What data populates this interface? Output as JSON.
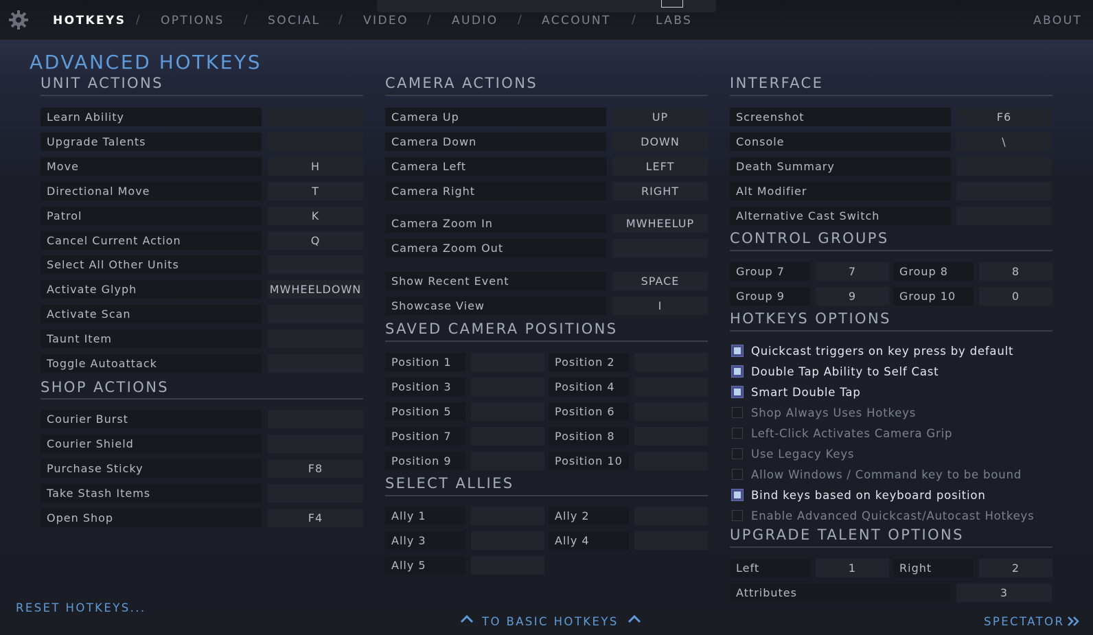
{
  "nav": {
    "tabs": [
      "HOTKEYS",
      "OPTIONS",
      "SOCIAL",
      "VIDEO",
      "AUDIO",
      "ACCOUNT",
      "LABS"
    ],
    "about": "ABOUT"
  },
  "page": {
    "title": "ADVANCED HOTKEYS"
  },
  "unit_actions": {
    "title": "UNIT ACTIONS",
    "rows": [
      {
        "label": "Learn Ability",
        "key": ""
      },
      {
        "label": "Upgrade Talents",
        "key": ""
      },
      {
        "label": "Move",
        "key": "H"
      },
      {
        "label": "Directional Move",
        "key": "T"
      },
      {
        "label": "Patrol",
        "key": "K"
      },
      {
        "label": "Cancel Current Action",
        "key": "Q"
      },
      {
        "label": "Select All Other Units",
        "key": ""
      },
      {
        "label": "Activate Glyph",
        "key": "MWHEELDOWN"
      },
      {
        "label": "Activate Scan",
        "key": ""
      },
      {
        "label": "Taunt Item",
        "key": ""
      },
      {
        "label": "Toggle Autoattack",
        "key": ""
      }
    ]
  },
  "shop_actions": {
    "title": "SHOP ACTIONS",
    "rows": [
      {
        "label": "Courier Burst",
        "key": ""
      },
      {
        "label": "Courier Shield",
        "key": ""
      },
      {
        "label": "Purchase Sticky",
        "key": "F8"
      },
      {
        "label": "Take Stash Items",
        "key": ""
      },
      {
        "label": "Open Shop",
        "key": "F4"
      }
    ]
  },
  "camera_actions": {
    "title": "CAMERA ACTIONS",
    "rows": [
      {
        "label": "Camera Up",
        "key": "UP"
      },
      {
        "label": "Camera Down",
        "key": "DOWN"
      },
      {
        "label": "Camera Left",
        "key": "LEFT"
      },
      {
        "label": "Camera Right",
        "key": "RIGHT"
      },
      {
        "label": "Camera Zoom In",
        "key": "MWHEELUP"
      },
      {
        "label": "Camera Zoom Out",
        "key": ""
      },
      {
        "label": "Show Recent Event",
        "key": "SPACE"
      },
      {
        "label": "Showcase View",
        "key": "I"
      }
    ]
  },
  "saved_camera": {
    "title": "SAVED CAMERA POSITIONS",
    "rows": [
      {
        "label": "Position 1",
        "key": ""
      },
      {
        "label": "Position 2",
        "key": ""
      },
      {
        "label": "Position 3",
        "key": ""
      },
      {
        "label": "Position 4",
        "key": ""
      },
      {
        "label": "Position 5",
        "key": ""
      },
      {
        "label": "Position 6",
        "key": ""
      },
      {
        "label": "Position 7",
        "key": ""
      },
      {
        "label": "Position 8",
        "key": ""
      },
      {
        "label": "Position 9",
        "key": ""
      },
      {
        "label": "Position 10",
        "key": ""
      }
    ]
  },
  "select_allies": {
    "title": "SELECT ALLIES",
    "rows": [
      {
        "label": "Ally 1",
        "key": ""
      },
      {
        "label": "Ally 2",
        "key": ""
      },
      {
        "label": "Ally 3",
        "key": ""
      },
      {
        "label": "Ally 4",
        "key": ""
      },
      {
        "label": "Ally 5",
        "key": ""
      }
    ]
  },
  "interface": {
    "title": "INTERFACE",
    "rows": [
      {
        "label": "Screenshot",
        "key": "F6"
      },
      {
        "label": "Console",
        "key": "\\"
      },
      {
        "label": "Death Summary",
        "key": ""
      },
      {
        "label": "Alt Modifier",
        "key": ""
      },
      {
        "label": "Alternative Cast Switch",
        "key": ""
      }
    ]
  },
  "control_groups": {
    "title": "CONTROL GROUPS",
    "rows": [
      {
        "label": "Group 7",
        "key": "7"
      },
      {
        "label": "Group 8",
        "key": "8"
      },
      {
        "label": "Group 9",
        "key": "9"
      },
      {
        "label": "Group 10",
        "key": "0"
      }
    ]
  },
  "hotkeys_options": {
    "title": "HOTKEYS OPTIONS",
    "items": [
      {
        "label": "Quickcast triggers on key press by default",
        "checked": true
      },
      {
        "label": "Double Tap Ability to Self Cast",
        "checked": true
      },
      {
        "label": "Smart Double Tap",
        "checked": true
      },
      {
        "label": "Shop Always Uses Hotkeys",
        "checked": false
      },
      {
        "label": "Left-Click Activates Camera Grip",
        "checked": false
      },
      {
        "label": "Use Legacy Keys",
        "checked": false
      },
      {
        "label": "Allow Windows / Command key to be bound",
        "checked": false
      },
      {
        "label": "Bind keys based on keyboard position",
        "checked": true
      },
      {
        "label": "Enable Advanced Quickcast/Autocast Hotkeys",
        "checked": false
      }
    ]
  },
  "upgrade_talent": {
    "title": "UPGRADE TALENT OPTIONS",
    "rows": [
      {
        "label": "Left",
        "key": "1"
      },
      {
        "label": "Right",
        "key": "2"
      },
      {
        "label": "Attributes",
        "key": "3"
      }
    ]
  },
  "footer": {
    "reset": "RESET HOTKEYS...",
    "basic": "TO BASIC HOTKEYS",
    "spectator": "SPECTATOR"
  },
  "colors": {
    "accent": "#5e9bd8",
    "checkbox_on": "#b7d4ea"
  }
}
